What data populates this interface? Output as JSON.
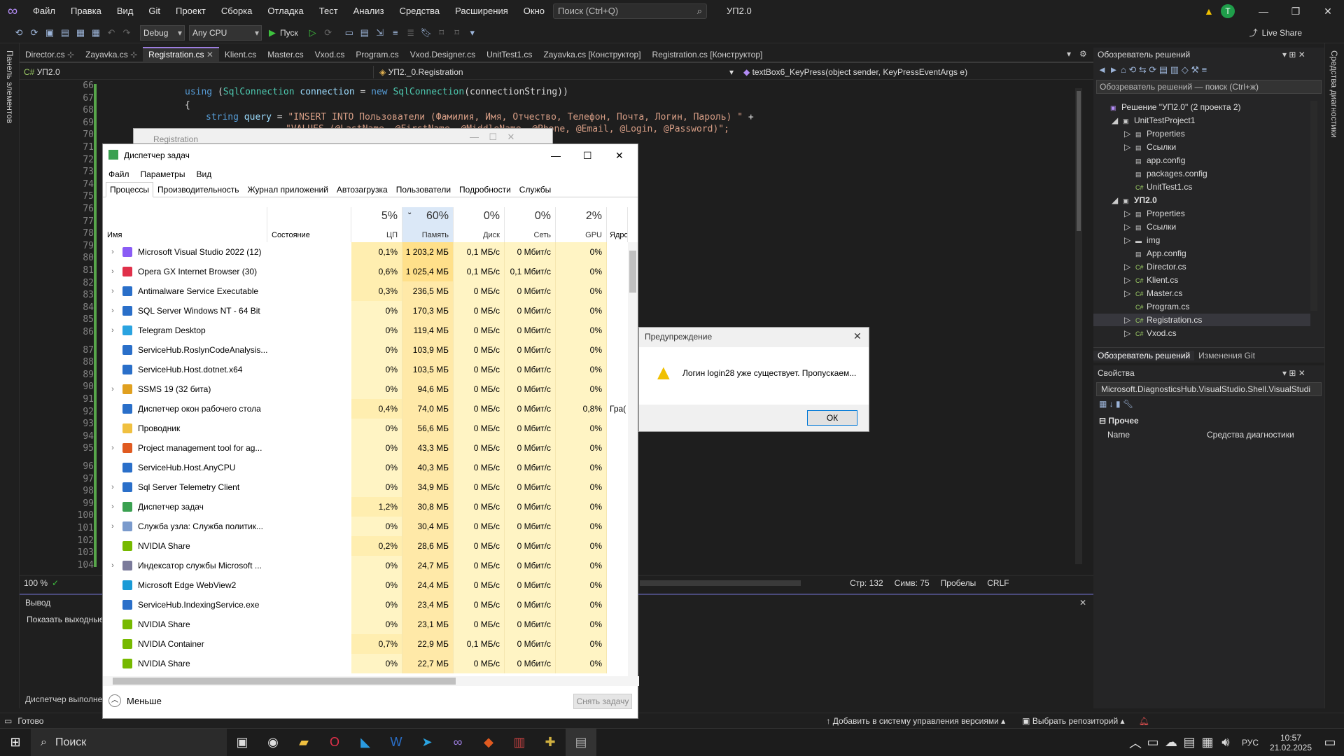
{
  "menubar": {
    "items": [
      "Файл",
      "Правка",
      "Вид",
      "Git",
      "Проект",
      "Сборка",
      "Отладка",
      "Тест",
      "Анализ",
      "Средства",
      "Расширения",
      "Окно",
      "Справка"
    ],
    "search": "Поиск (Ctrl+Q)",
    "project": "УП2.0",
    "avatar": "T"
  },
  "toolbar": {
    "config": "Debug",
    "platform": "Any CPU",
    "run": "Пуск",
    "liveshare": "Live Share"
  },
  "leftstrip": "Панель элементов",
  "rightstrip": "Средства диагностики",
  "tabs": [
    "Director.cs",
    "Zayavka.cs",
    "Registration.cs",
    "Klient.cs",
    "Master.cs",
    "Vxod.cs",
    "Program.cs",
    "Vxod.Designer.cs",
    "UnitTest1.cs",
    "Zayavka.cs [Конструктор]",
    "Registration.cs [Конструктор]"
  ],
  "navbar": {
    "project": "УП2.0",
    "class": "УП2._0.Registration",
    "member": "textBox6_KeyPress(object sender, KeyPressEventArgs e)"
  },
  "code": {
    "line_numbers": [
      "66",
      "67",
      "68",
      "69",
      "70",
      "71",
      "72",
      "73",
      "74",
      "75",
      "76",
      "77",
      "78",
      "79",
      "80",
      "81",
      "82",
      "83",
      "84",
      "85",
      "86",
      "87",
      "88",
      "89",
      "90",
      "91",
      "92",
      "93",
      "94",
      "95",
      "96",
      "97",
      "98",
      "99",
      "100",
      "101",
      "102",
      "103",
      "104"
    ],
    "l66": {
      "a": "using",
      "b": "(",
      "c": "SqlConnection",
      "d": " connection ",
      "e": "=",
      "f": " new ",
      "g": "SqlConnection",
      "h": "(connectionString))"
    },
    "l67": "{",
    "l68": {
      "a": "string",
      "b": " query ",
      "c": "= ",
      "d": "\"INSERT INTO Пользователи (Фамилия, Имя, Отчество, Телефон, Почта, Логин, Пароль) \"",
      "e": " +"
    },
    "l69": "\"VALUES (@LastName, @FirstName, @MiddleName, @Phone, @Email, @Login, @Password)\";"
  },
  "statusrow": {
    "zoom": "100 %",
    "line": "Стр: 132",
    "col": "Симв: 75",
    "spaces": "Пробелы",
    "eol": "CRLF"
  },
  "output": {
    "title": "Вывод",
    "show": "Показать выходные",
    "status": "Диспетчер выполне"
  },
  "bottomstatus": {
    "ready": "Готово",
    "vcs": "Добавить в систему управления версиями",
    "repo": "Выбрать репозиторий"
  },
  "solution": {
    "title": "Обозреватель решений",
    "search": "Обозреватель решений — поиск (Ctrl+ж)",
    "items": [
      {
        "label": "Решение \"УП2.0\" (2 проекта 2)",
        "indent": 0
      },
      {
        "label": "UnitTestProject1",
        "indent": 1
      },
      {
        "label": "Properties",
        "indent": 2
      },
      {
        "label": "Ссылки",
        "indent": 2
      },
      {
        "label": "app.config",
        "indent": 2
      },
      {
        "label": "packages.config",
        "indent": 2
      },
      {
        "label": "UnitTest1.cs",
        "indent": 2
      },
      {
        "label": "УП2.0",
        "indent": 1
      },
      {
        "label": "Properties",
        "indent": 2
      },
      {
        "label": "Ссылки",
        "indent": 2
      },
      {
        "label": "img",
        "indent": 2
      },
      {
        "label": "App.config",
        "indent": 2
      },
      {
        "label": "Director.cs",
        "indent": 2
      },
      {
        "label": "Klient.cs",
        "indent": 2
      },
      {
        "label": "Master.cs",
        "indent": 2
      },
      {
        "label": "Program.cs",
        "indent": 2
      },
      {
        "label": "Registration.cs",
        "indent": 2
      },
      {
        "label": "Vxod.cs",
        "indent": 2
      }
    ],
    "bottom_tabs": [
      "Обозреватель решений",
      "Изменения Git"
    ]
  },
  "properties": {
    "title": "Свойства",
    "object": "Microsoft.DiagnosticsHub.VisualStudio.Shell.VisualStudi",
    "category": "Прочее",
    "name_label": "Name",
    "name_value": "Средства диагностики"
  },
  "regwin": {
    "title": "Registration"
  },
  "taskmanager": {
    "title": "Диспетчер задач",
    "menu": [
      "Файл",
      "Параметры",
      "Вид"
    ],
    "tabs": [
      "Процессы",
      "Производительность",
      "Журнал приложений",
      "Автозагрузка",
      "Пользователи",
      "Подробности",
      "Службы"
    ],
    "headers": {
      "name": "Имя",
      "status": "Состояние",
      "cpu_pct": "5%",
      "cpu": "ЦП",
      "mem_pct": "60%",
      "mem": "Память",
      "disk_pct": "0%",
      "disk": "Диск",
      "net_pct": "0%",
      "net": "Сеть",
      "gpu_pct": "2%",
      "gpu": "GPU",
      "gpu_core": "Ядро G"
    },
    "rows": [
      {
        "name": "Microsoft Visual Studio 2022 (12)",
        "exp": true,
        "cpu": "0,1%",
        "mem": "1 203,2 МБ",
        "disk": "0,1 МБ/с",
        "net": "0 Мбит/с",
        "gpu": "0%",
        "core": "",
        "icon": "#8a5cf5"
      },
      {
        "name": "Opera GX Internet Browser (30)",
        "exp": true,
        "cpu": "0,6%",
        "mem": "1 025,4 МБ",
        "disk": "0,1 МБ/с",
        "net": "0,1 Мбит/с",
        "gpu": "0%",
        "core": "",
        "icon": "#e0304a"
      },
      {
        "name": "Antimalware Service Executable",
        "exp": true,
        "cpu": "0,3%",
        "mem": "236,5 МБ",
        "disk": "0 МБ/с",
        "net": "0 Мбит/с",
        "gpu": "0%",
        "core": "",
        "icon": "#2a6fc9"
      },
      {
        "name": "SQL Server Windows NT - 64 Bit",
        "exp": true,
        "cpu": "0%",
        "mem": "170,3 МБ",
        "disk": "0 МБ/с",
        "net": "0 Мбит/с",
        "gpu": "0%",
        "core": "",
        "icon": "#2a6fc9"
      },
      {
        "name": "Telegram Desktop",
        "exp": true,
        "cpu": "0%",
        "mem": "119,4 МБ",
        "disk": "0 МБ/с",
        "net": "0 Мбит/с",
        "gpu": "0%",
        "core": "",
        "icon": "#2aa3e0"
      },
      {
        "name": "ServiceHub.RoslynCodeAnalysis...",
        "exp": false,
        "cpu": "0%",
        "mem": "103,9 МБ",
        "disk": "0 МБ/с",
        "net": "0 Мбит/с",
        "gpu": "0%",
        "core": "",
        "icon": "#2a6fc9"
      },
      {
        "name": "ServiceHub.Host.dotnet.x64",
        "exp": false,
        "cpu": "0%",
        "mem": "103,5 МБ",
        "disk": "0 МБ/с",
        "net": "0 Мбит/с",
        "gpu": "0%",
        "core": "",
        "icon": "#2a6fc9"
      },
      {
        "name": "SSMS 19 (32 бита)",
        "exp": true,
        "cpu": "0%",
        "mem": "94,6 МБ",
        "disk": "0 МБ/с",
        "net": "0 Мбит/с",
        "gpu": "0%",
        "core": "",
        "icon": "#e0a020"
      },
      {
        "name": "Диспетчер окон рабочего стола",
        "exp": false,
        "cpu": "0,4%",
        "mem": "74,0 МБ",
        "disk": "0 МБ/с",
        "net": "0 Мбит/с",
        "gpu": "0,8%",
        "core": "Гра(",
        "icon": "#2a6fc9"
      },
      {
        "name": "Проводник",
        "exp": false,
        "cpu": "0%",
        "mem": "56,6 МБ",
        "disk": "0 МБ/с",
        "net": "0 Мбит/с",
        "gpu": "0%",
        "core": "",
        "icon": "#f0c040"
      },
      {
        "name": "Project management tool for ag...",
        "exp": true,
        "cpu": "0%",
        "mem": "43,3 МБ",
        "disk": "0 МБ/с",
        "net": "0 Мбит/с",
        "gpu": "0%",
        "core": "",
        "icon": "#e05a20"
      },
      {
        "name": "ServiceHub.Host.AnyCPU",
        "exp": false,
        "cpu": "0%",
        "mem": "40,3 МБ",
        "disk": "0 МБ/с",
        "net": "0 Мбит/с",
        "gpu": "0%",
        "core": "",
        "icon": "#2a6fc9"
      },
      {
        "name": "Sql Server Telemetry Client",
        "exp": true,
        "cpu": "0%",
        "mem": "34,9 МБ",
        "disk": "0 МБ/с",
        "net": "0 Мбит/с",
        "gpu": "0%",
        "core": "",
        "icon": "#2a6fc9"
      },
      {
        "name": "Диспетчер задач",
        "exp": true,
        "cpu": "1,2%",
        "mem": "30,8 МБ",
        "disk": "0 МБ/с",
        "net": "0 Мбит/с",
        "gpu": "0%",
        "core": "",
        "icon": "#3aa050"
      },
      {
        "name": "Служба узла: Служба политик...",
        "exp": true,
        "cpu": "0%",
        "mem": "30,4 МБ",
        "disk": "0 МБ/с",
        "net": "0 Мбит/с",
        "gpu": "0%",
        "core": "",
        "icon": "#7a9acc"
      },
      {
        "name": "NVIDIA Share",
        "exp": false,
        "cpu": "0,2%",
        "mem": "28,6 МБ",
        "disk": "0 МБ/с",
        "net": "0 Мбит/с",
        "gpu": "0%",
        "core": "",
        "icon": "#76b900"
      },
      {
        "name": "Индексатор службы Microsoft ...",
        "exp": true,
        "cpu": "0%",
        "mem": "24,7 МБ",
        "disk": "0 МБ/с",
        "net": "0 Мбит/с",
        "gpu": "0%",
        "core": "",
        "icon": "#7a7a9a"
      },
      {
        "name": "Microsoft Edge WebView2",
        "exp": false,
        "cpu": "0%",
        "mem": "24,4 МБ",
        "disk": "0 МБ/с",
        "net": "0 Мбит/с",
        "gpu": "0%",
        "core": "",
        "icon": "#1a9ad6"
      },
      {
        "name": "ServiceHub.IndexingService.exe",
        "exp": false,
        "cpu": "0%",
        "mem": "23,4 МБ",
        "disk": "0 МБ/с",
        "net": "0 Мбит/с",
        "gpu": "0%",
        "core": "",
        "icon": "#2a6fc9"
      },
      {
        "name": "NVIDIA Share",
        "exp": false,
        "cpu": "0%",
        "mem": "23,1 МБ",
        "disk": "0 МБ/с",
        "net": "0 Мбит/с",
        "gpu": "0%",
        "core": "",
        "icon": "#76b900"
      },
      {
        "name": "NVIDIA Container",
        "exp": false,
        "cpu": "0,7%",
        "mem": "22,9 МБ",
        "disk": "0,1 МБ/с",
        "net": "0 Мбит/с",
        "gpu": "0%",
        "core": "",
        "icon": "#76b900"
      },
      {
        "name": "NVIDIA Share",
        "exp": false,
        "cpu": "0%",
        "mem": "22,7 МБ",
        "disk": "0 МБ/с",
        "net": "0 Мбит/с",
        "gpu": "0%",
        "core": "",
        "icon": "#76b900"
      }
    ],
    "fewer": "Меньше",
    "end_task": "Снять задачу"
  },
  "warning": {
    "title": "Предупреждение",
    "message": "Логин login28 уже существует. Пропускаем...",
    "ok": "ОК"
  },
  "taskbar": {
    "search": "Поиск",
    "lang": "РУС",
    "time": "10:57",
    "date": "21.02.2025"
  },
  "colors": {
    "accent": "#9d7ee0",
    "editor_bg": "#1e1e1e",
    "highlight": "#fff4c4"
  }
}
